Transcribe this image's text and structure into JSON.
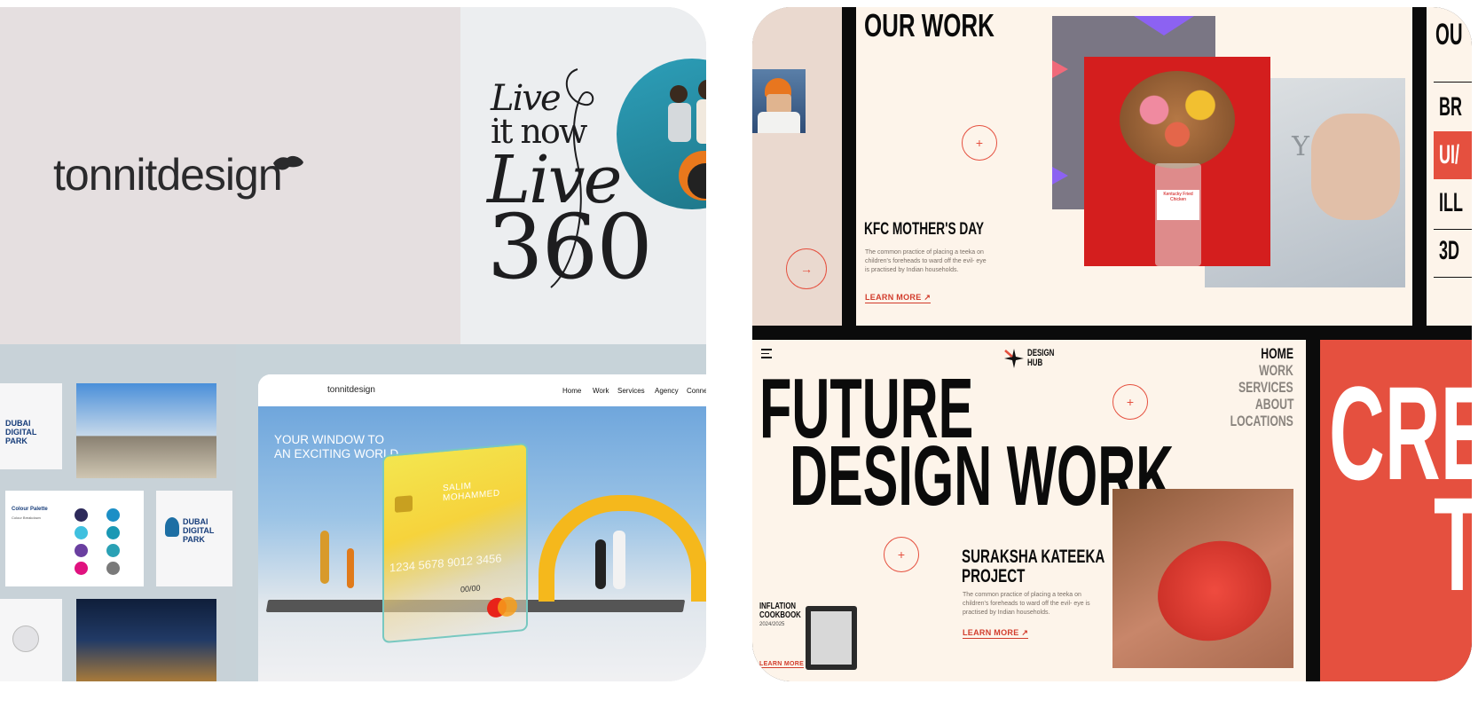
{
  "left": {
    "logo": "tonnitdesign",
    "live_lines": [
      "Live",
      "it now",
      "Live",
      "360"
    ],
    "site": {
      "logo": "tonnitdesign",
      "nav": [
        "Home",
        "Work",
        "Services",
        "Agency",
        "Connect"
      ],
      "hero_line1": "YOUR WINDOW TO",
      "hero_line2": "AN EXCITING WORLD",
      "card_name": "SALIM MOHAMMED",
      "card_number": "1234  5678  9012  3456",
      "card_expiry": "00/00"
    },
    "brand_book": {
      "title": "DUBAI DIGITAL PARK",
      "palette_title": "Colour Palette",
      "palette_sub": "Colour Breakdown",
      "palette_colors": [
        "#2d2a5a",
        "#1c8fc6",
        "#3fc0df",
        "#1a98b4",
        "#6a3fa0",
        "#2aa1b5",
        "#e0127f",
        "#7a7a7a"
      ]
    }
  },
  "right": {
    "kfc": {
      "heading": "OUR WORK",
      "project_title": "KFC MOTHER'S DAY",
      "body": "The common practice of placing a teeka on children's foreheads to ward off the evil- eye is practised by Indian households.",
      "learn_more": "LEARN MORE",
      "arrow": "→",
      "plus": "+",
      "letters": "S Y",
      "jar_label": "Kentucky Fried Chicken"
    },
    "side_menu": {
      "heading": "OU",
      "items": [
        "BR",
        "UI/",
        "ILL",
        "3D"
      ]
    },
    "future": {
      "brand_line1": "DESIGN",
      "brand_line2": "HUB",
      "headline1": "FUTURE",
      "headline2": "DESIGN WORK",
      "menu": [
        "HOME",
        "WORK",
        "SERVICES",
        "ABOUT",
        "LOCATIONS"
      ],
      "project_title1": "SURAKSHA KATEEKA",
      "project_title2": "PROJECT",
      "body": "The common practice of placing a teeka on children's foreheads to ward off the evil- eye is practised by Indian households.",
      "learn_more": "LEARN MORE",
      "arrow_ne": "↗",
      "book_title1": "INFLATION",
      "book_title2": "COOKBOOK",
      "book_year": "2024/2025",
      "book_learn": "LEARN MORE",
      "plus": "+"
    },
    "red_panel": {
      "line1": "CRE",
      "line2": "T"
    }
  },
  "colors": {
    "accent_red": "#e5503f",
    "cream": "#fdf4ea",
    "ink": "#0b0b0b"
  }
}
